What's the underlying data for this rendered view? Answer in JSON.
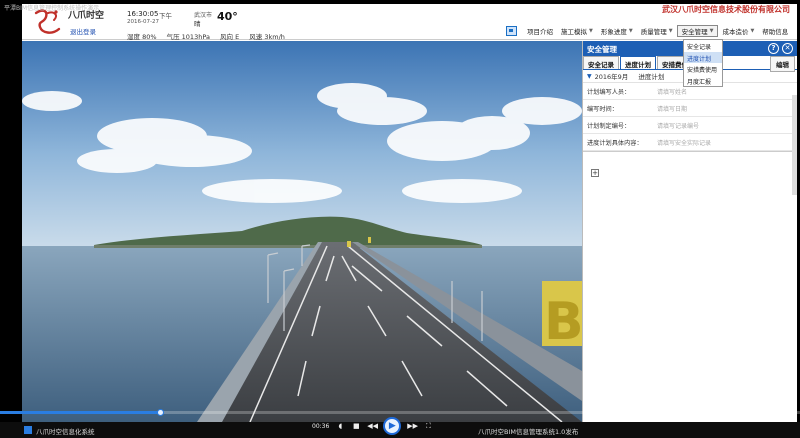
{
  "window": {
    "title": "平潭BIM信息管理控制系统操作演示"
  },
  "header": {
    "brand_name": "八爪时空",
    "logout_label": "退出登录",
    "time": "16:30:05",
    "ampm": "下午",
    "date": "2016-07-27",
    "city": "武汉市",
    "condition": "晴",
    "temperature": "40°",
    "humidity": "湿度  80%",
    "pressure": "气压  1013hPa",
    "wind_dir": "风向   E",
    "wind_speed": "风速   3km/h",
    "company": "武汉八爪时空信息技术股份有限公司"
  },
  "nav": {
    "items": [
      {
        "label": "项目介绍"
      },
      {
        "label": "施工模拟"
      },
      {
        "label": "形象进度"
      },
      {
        "label": "质量管理"
      },
      {
        "label": "安全管理"
      },
      {
        "label": "成本造价"
      },
      {
        "label": "帮助信息"
      }
    ]
  },
  "dropdown": {
    "items": [
      {
        "label": "安全记录"
      },
      {
        "label": "进度计划"
      },
      {
        "label": "安措费使用"
      },
      {
        "label": "月度汇报"
      }
    ]
  },
  "panel": {
    "title": "安全管理",
    "help": "?",
    "close": "✕",
    "tabs": [
      {
        "label": "安全记录"
      },
      {
        "label": "进度计划"
      },
      {
        "label": "安措费使"
      },
      {
        "label": "报"
      }
    ],
    "edit_label": "编辑",
    "period": {
      "month": "2016年9月",
      "plan": "进度计划"
    },
    "rows": [
      {
        "label": "计划编写人员：",
        "placeholder": "请填写姓名"
      },
      {
        "label": "编写时间：",
        "placeholder": "请填写日期"
      },
      {
        "label": "计划制定编号：",
        "placeholder": "请填写记录编号"
      },
      {
        "label": "进度计划具体内容：",
        "placeholder": "请填写安全实际记录"
      }
    ],
    "add_label": "+"
  },
  "scene": {
    "sign_text": "B"
  },
  "player": {
    "time": "00:36",
    "progress": 0.2
  },
  "taskbar": {
    "left_label": "八爪时空信息化系统",
    "right_label": "八爪时空BIM信息管理系统1.0发布"
  }
}
